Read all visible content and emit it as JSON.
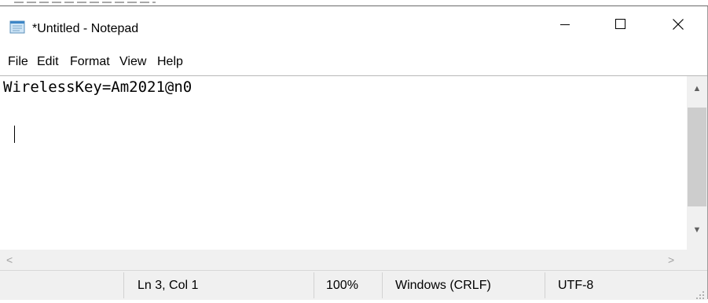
{
  "window": {
    "title": "*Untitled - Notepad",
    "icon": "notepad-icon",
    "controls": {
      "minimize": "minimize-icon",
      "maximize": "maximize-icon",
      "close": "close-icon"
    }
  },
  "menu": {
    "items": [
      "File",
      "Edit",
      "Format",
      "View",
      "Help"
    ]
  },
  "editor": {
    "lines": [
      "WirelessKey=Am2021@n0",
      "",
      ""
    ]
  },
  "status": {
    "position": "Ln 3, Col 1",
    "zoom": "100%",
    "line_endings": "Windows (CRLF)",
    "encoding": "UTF-8"
  },
  "colors": {
    "status_bar_bg": "#f0f0f0",
    "scrollbar_thumb": "#cdcdcd"
  }
}
